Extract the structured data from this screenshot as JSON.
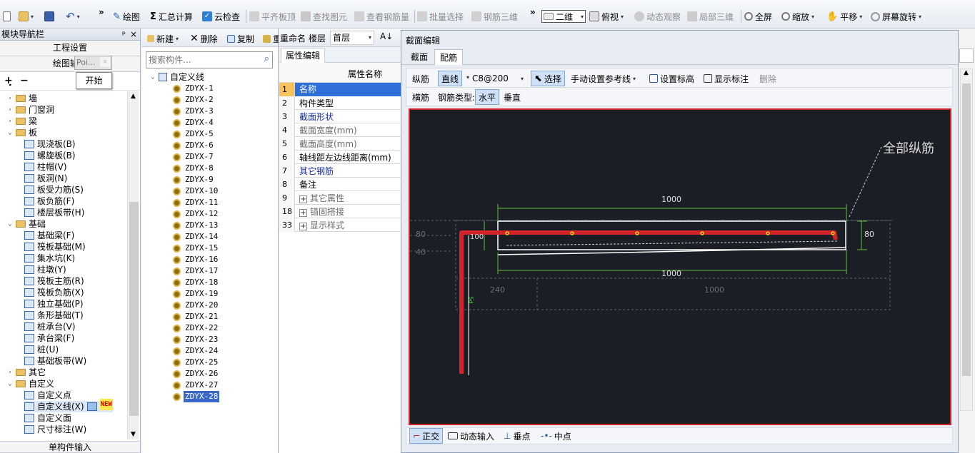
{
  "toolbar": {
    "draw": "绘图",
    "sum": "汇总计算",
    "cloud_check": "云检查",
    "align_slab_top": "平齐板顶",
    "find_element": "查找图元",
    "view_rebar": "查看钢筋量",
    "batch_select": "批量选择",
    "rebar_3d": "钢筋三维",
    "view_mode": "二维",
    "top_view": "俯视",
    "dynamic_observe": "动态观察",
    "local_3d": "局部三维",
    "fullscreen": "全屏",
    "zoom": "缩放",
    "pan": "平移",
    "screen_rotate": "屏幕旋转"
  },
  "nav": {
    "title": "模块导航栏",
    "pin": "ᵖ",
    "close": "×",
    "project_settings": "工程设置",
    "drawing_input": "绘图输",
    "start_popup": "开始",
    "popup_tab": "Poi...",
    "single_input": "单构件输入",
    "items": [
      {
        "label": "墙",
        "level": 1,
        "folder": true,
        "state": ">"
      },
      {
        "label": "门窗洞",
        "level": 1,
        "folder": true,
        "state": ">"
      },
      {
        "label": "梁",
        "level": 1,
        "folder": true,
        "state": ">"
      },
      {
        "label": "板",
        "level": 1,
        "folder": true,
        "state": "v"
      },
      {
        "label": "现浇板(B)",
        "level": 2
      },
      {
        "label": "螺旋板(B)",
        "level": 2
      },
      {
        "label": "柱帽(V)",
        "level": 2
      },
      {
        "label": "板洞(N)",
        "level": 2
      },
      {
        "label": "板受力筋(S)",
        "level": 2
      },
      {
        "label": "板负筋(F)",
        "level": 2
      },
      {
        "label": "楼层板带(H)",
        "level": 2
      },
      {
        "label": "基础",
        "level": 1,
        "folder": true,
        "state": "v"
      },
      {
        "label": "基础梁(F)",
        "level": 2
      },
      {
        "label": "筏板基础(M)",
        "level": 2
      },
      {
        "label": "集水坑(K)",
        "level": 2
      },
      {
        "label": "柱墩(Y)",
        "level": 2
      },
      {
        "label": "筏板主筋(R)",
        "level": 2
      },
      {
        "label": "筏板负筋(X)",
        "level": 2
      },
      {
        "label": "独立基础(P)",
        "level": 2
      },
      {
        "label": "条形基础(T)",
        "level": 2
      },
      {
        "label": "桩承台(V)",
        "level": 2
      },
      {
        "label": "承台梁(F)",
        "level": 2
      },
      {
        "label": "桩(U)",
        "level": 2
      },
      {
        "label": "基础板带(W)",
        "level": 2
      },
      {
        "label": "其它",
        "level": 1,
        "folder": true,
        "state": ">"
      },
      {
        "label": "自定义",
        "level": 1,
        "folder": true,
        "state": "v"
      },
      {
        "label": "自定义点",
        "level": 2
      },
      {
        "label": "自定义线(X)",
        "level": 2,
        "badge": "NEW",
        "selected": true
      },
      {
        "label": "自定义面",
        "level": 2
      },
      {
        "label": "尺寸标注(W)",
        "level": 2
      }
    ]
  },
  "components": {
    "new": "新建",
    "delete": "删除",
    "copy": "复制",
    "rename": "重命名",
    "floor_label": "楼层",
    "floor_value": "首层",
    "search_placeholder": "搜索构件...",
    "root": "自定义线",
    "items": [
      "ZDYX-1",
      "ZDYX-2",
      "ZDYX-3",
      "ZDYX-4",
      "ZDYX-5",
      "ZDYX-6",
      "ZDYX-7",
      "ZDYX-8",
      "ZDYX-9",
      "ZDYX-10",
      "ZDYX-11",
      "ZDYX-12",
      "ZDYX-13",
      "ZDYX-14",
      "ZDYX-15",
      "ZDYX-16",
      "ZDYX-17",
      "ZDYX-18",
      "ZDYX-19",
      "ZDYX-20",
      "ZDYX-21",
      "ZDYX-22",
      "ZDYX-23",
      "ZDYX-24",
      "ZDYX-25",
      "ZDYX-26",
      "ZDYX-27",
      "ZDYX-28"
    ],
    "selected": "ZDYX-28"
  },
  "properties": {
    "tab": "属性编辑",
    "header": "属性名称",
    "rows": [
      {
        "num": "1",
        "name": "名称",
        "style": "selected"
      },
      {
        "num": "2",
        "name": "构件类型",
        "style": "normal"
      },
      {
        "num": "3",
        "name": "截面形状",
        "style": "blue"
      },
      {
        "num": "4",
        "name": "截面宽度(mm)",
        "style": "grey"
      },
      {
        "num": "5",
        "name": "截面高度(mm)",
        "style": "grey"
      },
      {
        "num": "6",
        "name": "轴线距左边线距离(mm)",
        "style": "normal"
      },
      {
        "num": "7",
        "name": "其它钢筋",
        "style": "blue"
      },
      {
        "num": "8",
        "name": "备注",
        "style": "normal"
      },
      {
        "num": "9",
        "name": "其它属性",
        "style": "grey",
        "expand": "+"
      },
      {
        "num": "18",
        "name": "锚固搭接",
        "style": "grey",
        "expand": "+"
      },
      {
        "num": "33",
        "name": "显示样式",
        "style": "grey",
        "expand": "+"
      }
    ]
  },
  "section_editor": {
    "title": "截面编辑",
    "tabs": [
      "截面",
      "配筋"
    ],
    "longitudinal": "纵筋",
    "line": "直线",
    "rebar_spec": "C8@200",
    "select": "选择",
    "manual_ref": "手动设置参考线",
    "set_elevation": "设置标高",
    "show_labels": "显示标注",
    "delete": "删除",
    "transverse": "横筋",
    "rebar_type": "钢筋类型:",
    "horizontal": "水平",
    "vertical": "垂直",
    "canvas": {
      "all_long": "全部纵筋",
      "dim_top": "1000",
      "dim_bottom": "1000",
      "dim_right": "80",
      "dim_left_100": "100",
      "dim_80": "80",
      "dim_40": "40",
      "dim_240": "240",
      "dim_1000_grey": "1000",
      "v_label": "5d"
    },
    "bottom": {
      "ortho": "正交",
      "dynamic_input": "动态输入",
      "perp_point": "垂点",
      "mid_point": "中点"
    }
  }
}
